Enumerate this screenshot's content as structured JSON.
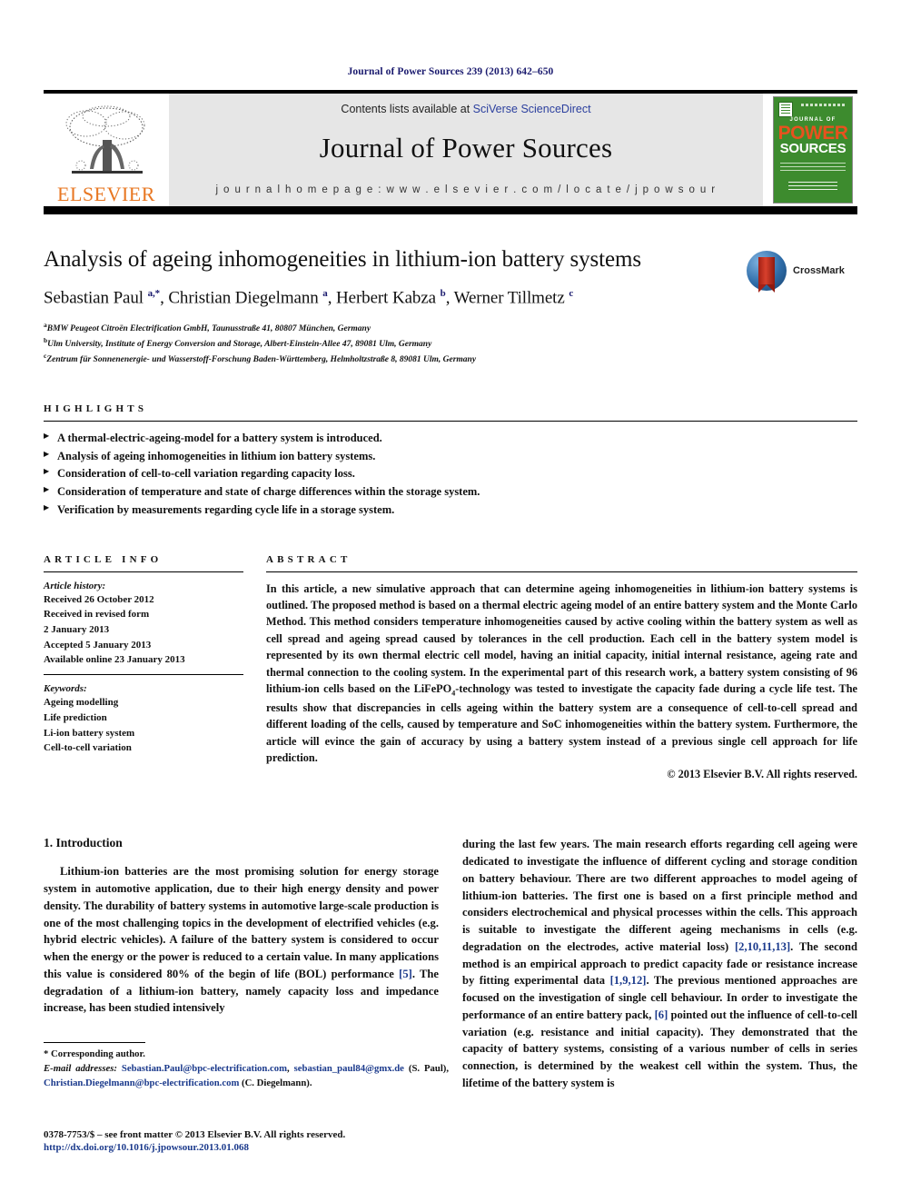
{
  "running_head": "Journal of Power Sources 239 (2013) 642–650",
  "masthead": {
    "publisher_name": "ELSEVIER",
    "contents_prefix": "Contents lists available at ",
    "contents_link": "SciVerse ScienceDirect",
    "journal_title": "Journal of Power Sources",
    "homepage": "j o u r n a l   h o m e p a g e :   w w w . e l s e v i e r . c o m / l o c a t e / j p o w s o u r",
    "cover": {
      "journal_of": "JOURNAL OF",
      "power": "POWER",
      "sources": "SOURCES"
    },
    "link_color": "#2b3f9e"
  },
  "article": {
    "title": "Analysis of ageing inhomogeneities in lithium-ion battery systems",
    "authors_html": "Sebastian Paul <sup>a,*</sup>, Christian Diegelmann <sup>a</sup>, Herbert Kabza <sup>b</sup>, Werner Tillmetz <sup>c</sup>",
    "affiliations": [
      "BMW Peugeot Citroën Electrification GmbH, Taunusstraße 41, 80807 München, Germany",
      "Ulm University, Institute of Energy Conversion and Storage, Albert-Einstein-Allee 47, 89081 Ulm, Germany",
      "Zentrum für Sonnenenergie- und Wasserstoff-Forschung Baden-Württemberg, Helmholtzstraße 8, 89081 Ulm, Germany"
    ],
    "affiliation_marks": [
      "a",
      "b",
      "c"
    ],
    "crossmark_label": "CrossMark"
  },
  "highlights": {
    "heading": "HIGHLIGHTS",
    "items": [
      "A thermal-electric-ageing-model for a battery system is introduced.",
      "Analysis of ageing inhomogeneities in lithium ion battery systems.",
      "Consideration of cell-to-cell variation regarding capacity loss.",
      "Consideration of temperature and state of charge differences within the storage system.",
      "Verification by measurements regarding cycle life in a storage system."
    ]
  },
  "article_info": {
    "heading": "ARTICLE INFO",
    "history_label": "Article history:",
    "history": [
      "Received 26 October 2012",
      "Received in revised form",
      "2 January 2013",
      "Accepted 5 January 2013",
      "Available online 23 January 2013"
    ],
    "keywords_label": "Keywords:",
    "keywords": [
      "Ageing modelling",
      "Life prediction",
      "Li-ion battery system",
      "Cell-to-cell variation"
    ]
  },
  "abstract": {
    "heading": "ABSTRACT",
    "text_html": "In this article, a new simulative approach that can determine ageing inhomogeneities in lithium-ion battery systems is outlined. The proposed method is based on a thermal electric ageing model of an entire battery system and the Monte Carlo Method. This method considers temperature inhomogeneities caused by active cooling within the battery system as well as cell spread and ageing spread caused by tolerances in the cell production. Each cell in the battery system model is represented by its own thermal electric cell model, having an initial capacity, initial internal resistance, ageing rate and thermal connection to the cooling system. In the experimental part of this research work, a battery system consisting of 96 lithium-ion cells based on the LiFePO<sub>4</sub>-technology was tested to investigate the capacity fade during a cycle life test. The results show that discrepancies in cells ageing within the battery system are a consequence of cell-to-cell spread and different loading of the cells, caused by temperature and SoC inhomogeneities within the battery system. Furthermore, the article will evince the gain of accuracy by using a battery system instead of a previous single cell approach for life prediction.",
    "copyright": "© 2013 Elsevier B.V. All rights reserved."
  },
  "introduction": {
    "heading": "1. Introduction",
    "left_html": "Lithium-ion batteries are the most promising solution for energy storage system in automotive application, due to their high energy density and power density. The durability of battery systems in automotive large-scale production is one of the most challenging topics in the development of electrified vehicles (e.g. hybrid electric vehicles). A failure of the battery system is considered to occur when the energy or the power is reduced to a certain value. In many applications this value is considered 80% of the begin of life (BOL) performance <span class=\"ref\">[5]</span>. The degradation of a lithium-ion battery, namely capacity loss and impedance increase, has been studied intensively",
    "right_html": "during the last few years. The main research efforts regarding cell ageing were dedicated to investigate the influence of different cycling and storage condition on battery behaviour. There are two different approaches to model ageing of lithium-ion batteries. The first one is based on a first principle method and considers electrochemical and physical processes within the cells. This approach is suitable to investigate the different ageing mechanisms in cells (e.g. degradation on the electrodes, active material loss) <span class=\"ref\">[2,10,11,13]</span>. The second method is an empirical approach to predict capacity fade or resistance increase by fitting experimental data <span class=\"ref\">[1,9,12]</span>. The previous mentioned approaches are focused on the investigation of single cell behaviour. In order to investigate the performance of an entire battery pack, <span class=\"ref\">[6]</span> pointed out the influence of cell-to-cell variation (e.g. resistance and initial capacity). They demonstrated that the capacity of battery systems, consisting of a various number of cells in series connection, is determined by the weakest cell within the system. Thus, the lifetime of the battery system is"
  },
  "footnote": {
    "corresponding": "* Corresponding author.",
    "email_label": "E-mail addresses:",
    "email_1": "Sebastian.Paul@bpc-electrification.com",
    "email_2": "sebastian_paul84@gmx.de",
    "email_1_attr": " (S. Paul), ",
    "email_3": "Christian.Diegelmann@bpc-electrification.com",
    "email_3_attr": " (C. Diegelmann)."
  },
  "imprint": {
    "line1": "0378-7753/$ – see front matter © 2013 Elsevier B.V. All rights reserved.",
    "line2": "http://dx.doi.org/10.1016/j.jpowsour.2013.01.068"
  }
}
